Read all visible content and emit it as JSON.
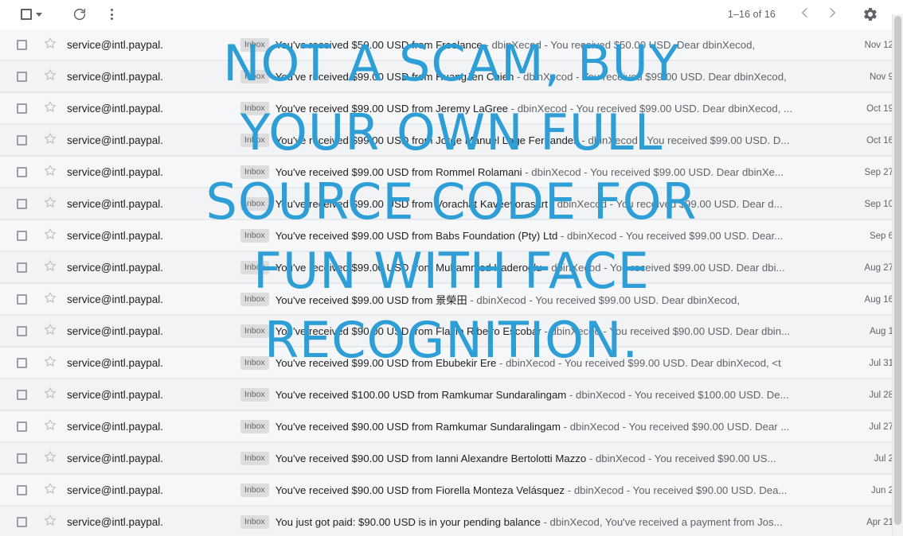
{
  "toolbar": {
    "select_all_icon": "checkbox-icon",
    "select_all_dropdown_icon": "chevron-down-icon",
    "refresh_icon": "refresh-icon",
    "more_icon": "more-vertical-icon",
    "page_count": "1–16 of 16",
    "prev_icon": "chevron-left-icon",
    "next_icon": "chevron-right-icon",
    "settings_icon": "gear-icon"
  },
  "watermark": {
    "color": "#2e9ed6",
    "lines": [
      "NOT A SCAM, BUY",
      "YOUR OWN FULL",
      "SOURCE CODE FOR",
      "FUN WITH FACE",
      "RECOGNITION."
    ]
  },
  "mail": {
    "label_chip": "Inbox",
    "sender": "service@intl.paypal.",
    "rows": [
      {
        "sender": "service@intl.paypal.",
        "label": "Inbox",
        "subject": "You've received $50.00 USD from Freelance",
        "snippet": " - dbinXecod - You received $50.00 USD. Dear dbinXecod,",
        "date": "Nov 12"
      },
      {
        "sender": "service@intl.paypal.",
        "label": "Inbox",
        "subject": "You've received $99.00 USD from HuangJen Chien",
        "snippet": " - dbinXecod - You received $99.00 USD. Dear dbinXecod,",
        "date": "Nov 9"
      },
      {
        "sender": "service@intl.paypal.",
        "label": "Inbox",
        "subject": "You've received $99.00 USD from Jeremy LaGree",
        "snippet": " - dbinXecod - You received $99.00 USD. Dear dbinXecod, ...",
        "date": "Oct 19"
      },
      {
        "sender": "service@intl.paypal.",
        "label": "Inbox",
        "subject": "You've received $99.00 USD from Jorge Manuel Lage Fernandes",
        "snippet": " - dbinXecod - You received $99.00 USD. D...",
        "date": "Oct 16"
      },
      {
        "sender": "service@intl.paypal.",
        "label": "Inbox",
        "subject": "You've received $99.00 USD from Rommel Rolamani",
        "snippet": " - dbinXecod - You received $99.00 USD. Dear dbinXe...",
        "date": "Sep 27"
      },
      {
        "sender": "service@intl.paypal.",
        "label": "Inbox",
        "subject": "You've received $99.00 USD from Vorachat Kaveevorasart",
        "snippet": " - dbinXecod - You received $99.00 USD. Dear d...",
        "date": "Sep 10"
      },
      {
        "sender": "service@intl.paypal.",
        "label": "Inbox",
        "subject": "You've received $99.00 USD from Babs Foundation (Pty) Ltd",
        "snippet": " - dbinXecod - You received $99.00 USD. Dear...",
        "date": "Sep 6"
      },
      {
        "sender": "service@intl.paypal.",
        "label": "Inbox",
        "subject": "You've received $99.00 USD from Muhammed Kaderoglu",
        "snippet": " - dbinXecod - You received $99.00 USD. Dear dbi...",
        "date": "Aug 27"
      },
      {
        "sender": "service@intl.paypal.",
        "label": "Inbox",
        "subject": "You've received $99.00 USD from 景榮田",
        "snippet": " - dbinXecod - You received $99.00 USD. Dear dbinXecod,",
        "date": "Aug 16"
      },
      {
        "sender": "service@intl.paypal.",
        "label": "Inbox",
        "subject": "You've received $90.00 USD from Flavio Ribeiro Escobar",
        "snippet": " - dbinXecod - You received $90.00 USD. Dear dbin...",
        "date": "Aug 1"
      },
      {
        "sender": "service@intl.paypal.",
        "label": "Inbox",
        "subject": "You've received $99.00 USD from Ebubekir Ere",
        "snippet": " - dbinXecod - You received $99.00 USD. Dear dbinXecod, <t",
        "date": "Jul 31"
      },
      {
        "sender": "service@intl.paypal.",
        "label": "Inbox",
        "subject": "You've received $100.00 USD from Ramkumar Sundaralingam",
        "snippet": " - dbinXecod - You received $100.00 USD. De...",
        "date": "Jul 28"
      },
      {
        "sender": "service@intl.paypal.",
        "label": "Inbox",
        "subject": "You've received $90.00 USD from Ramkumar Sundaralingam",
        "snippet": " - dbinXecod - You received $90.00 USD. Dear ...",
        "date": "Jul 27"
      },
      {
        "sender": "service@intl.paypal.",
        "label": "Inbox",
        "subject": "You've received $90.00 USD from Ianni Alexandre Bertolotti Mazzo",
        "snippet": " - dbinXecod - You received $90.00 US...",
        "date": "Jul 2"
      },
      {
        "sender": "service@intl.paypal.",
        "label": "Inbox",
        "subject": "You've received $90.00 USD from Fiorella Monteza Velásquez",
        "snippet": " - dbinXecod - You received $90.00 USD. Dea...",
        "date": "Jun 2"
      },
      {
        "sender": "service@intl.paypal.",
        "label": "Inbox",
        "subject": "You just got paid: $90.00 USD is in your pending balance",
        "snippet": " - dbinXecod, You've received a payment from Jos...",
        "date": "Apr 21"
      }
    ]
  }
}
